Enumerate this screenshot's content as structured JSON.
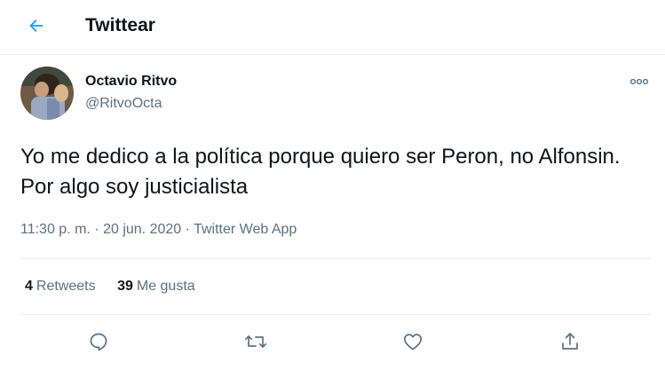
{
  "header": {
    "title": "Twittear",
    "back_icon": "arrow-left-icon",
    "accent": "#1da1f2"
  },
  "tweet": {
    "author": {
      "name": "Octavio Ritvo",
      "handle": "@RitvoOcta"
    },
    "text": "Yo me dedico a la política porque quiero ser Peron, no Alfonsin. Por algo soy justicialista",
    "timestamp": "11:30 p. m. · 20 jun. 2020 · Twitter Web App",
    "stats": {
      "retweets_count": "4",
      "retweets_label": "Retweets",
      "likes_count": "39",
      "likes_label": "Me gusta"
    },
    "actions": [
      "reply-icon",
      "retweet-icon",
      "like-icon",
      "share-icon"
    ]
  },
  "colors": {
    "text": "#0f1419",
    "secondary": "#5b7083",
    "divider": "#ebeef0"
  }
}
